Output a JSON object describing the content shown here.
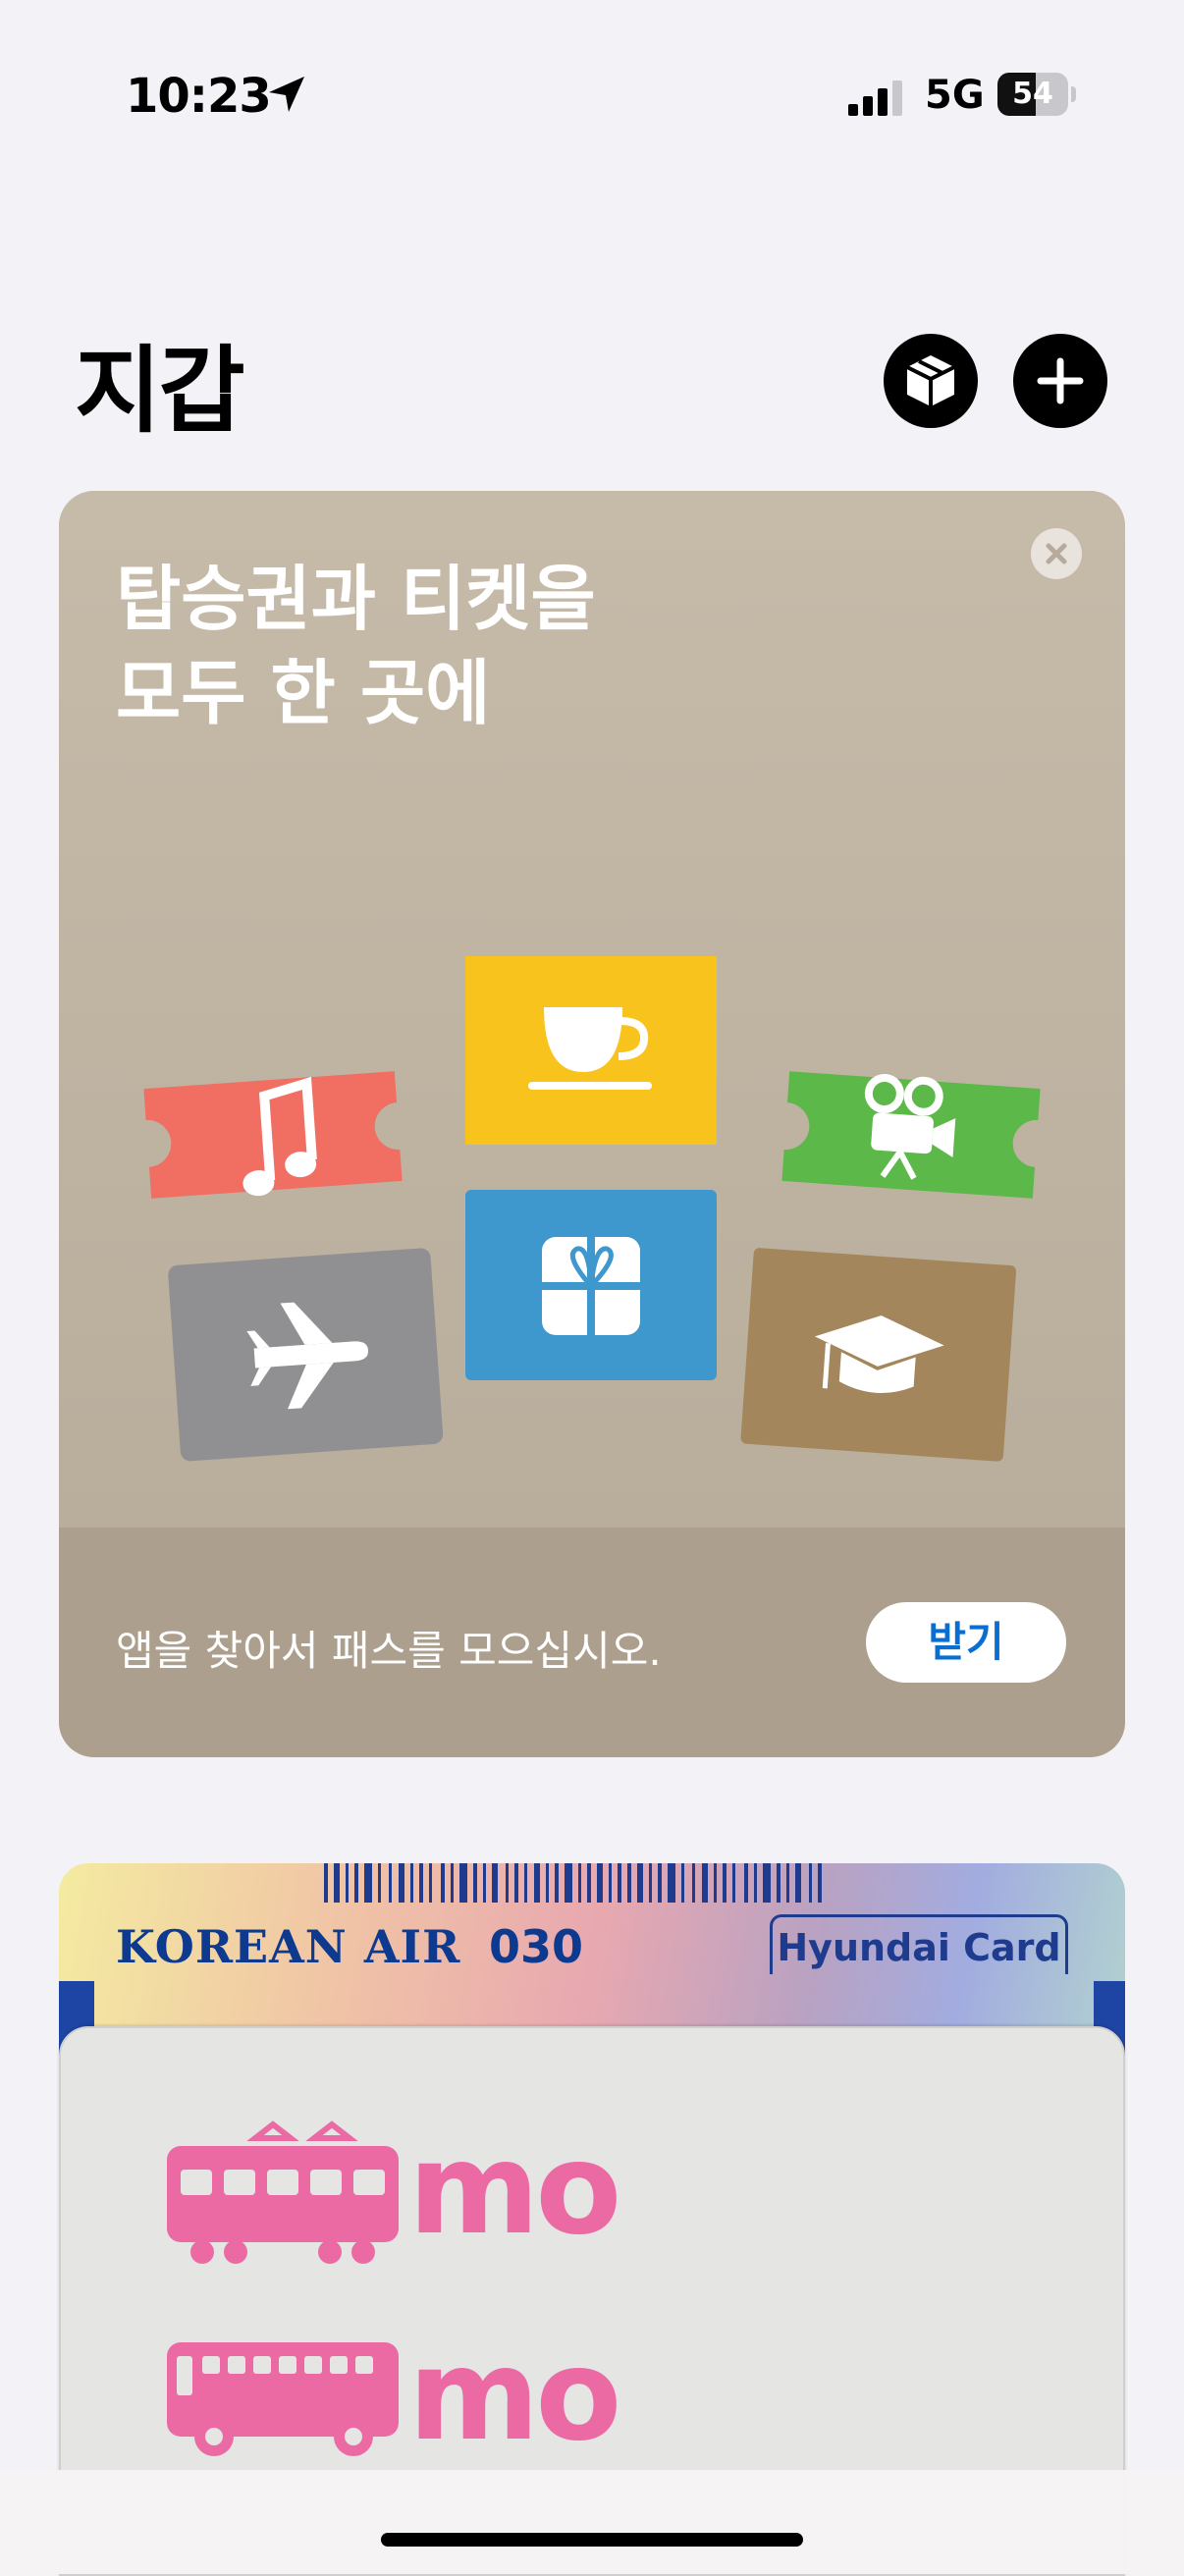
{
  "status_bar": {
    "time": "10:23",
    "network": "5G",
    "battery_percent": "54",
    "battery_level": 0.54
  },
  "header": {
    "title": "지갑"
  },
  "promo": {
    "title_line1": "탑승권과 티켓을",
    "title_line2": "모두 한 곳에",
    "footer_text": "앱을 찾아서 패스를 모으십시오.",
    "get_label": "받기"
  },
  "passes": {
    "boarding": {
      "airline": "KOREAN AIR",
      "number": "030",
      "issuer": "Hyundai Card"
    },
    "transit": {
      "tram_label": "mo",
      "bus_label": "mo"
    }
  },
  "colors": {
    "accent_blue": "#0a6ed1",
    "brand_pink": "#ec6aa4",
    "korean_air_blue": "#0d3a8f"
  }
}
